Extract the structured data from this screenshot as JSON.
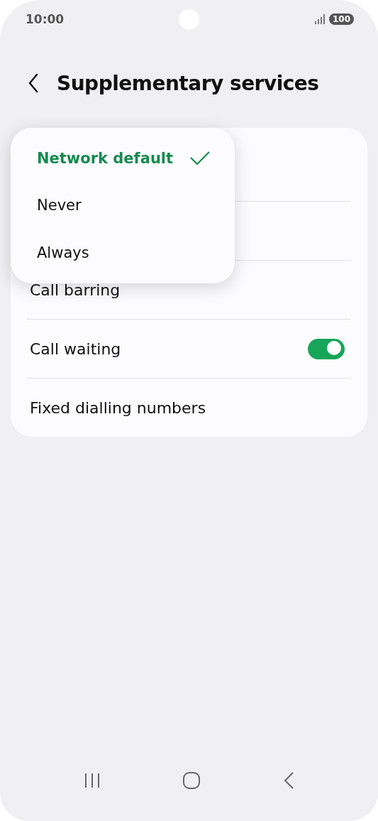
{
  "status_bar": {
    "time": "10:00",
    "battery": "100"
  },
  "header": {
    "title": "Supplementary services"
  },
  "menu": {
    "items": [
      {
        "label": "Network default",
        "selected": true
      },
      {
        "label": "Never",
        "selected": false
      },
      {
        "label": "Always",
        "selected": false
      }
    ]
  },
  "settings": {
    "rows": [
      {
        "label": "Call barring",
        "kind": "link"
      },
      {
        "label": "Call waiting",
        "kind": "toggle",
        "on": true
      },
      {
        "label": "Fixed dialling numbers",
        "kind": "link"
      }
    ]
  }
}
